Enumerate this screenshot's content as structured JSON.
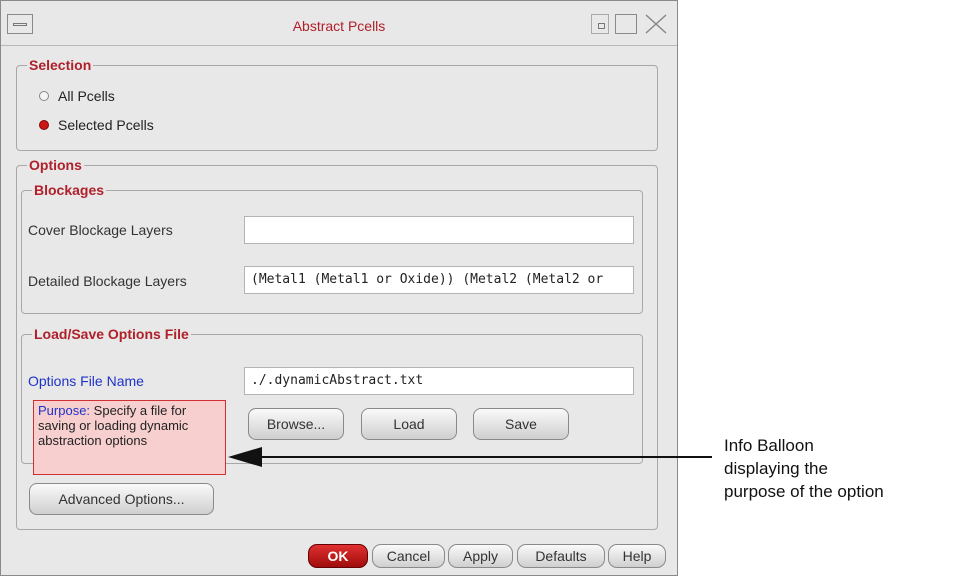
{
  "window": {
    "title": "Abstract Pcells"
  },
  "selection": {
    "legend": "Selection",
    "options": [
      {
        "label": "All Pcells",
        "selected": false
      },
      {
        "label": "Selected Pcells",
        "selected": true
      }
    ]
  },
  "options": {
    "legend": "Options",
    "blockages": {
      "legend": "Blockages",
      "cover_label": "Cover Blockage Layers",
      "cover_value": "",
      "detailed_label": "Detailed Blockage Layers",
      "detailed_value": "(Metal1 (Metal1 or Oxide)) (Metal2 (Metal2 or"
    },
    "load_save": {
      "legend": "Load/Save Options File",
      "file_label": "Options File Name",
      "file_value": "./.dynamicAbstract.txt",
      "browse_label": "Browse...",
      "load_label": "Load",
      "save_label": "Save"
    },
    "advanced_label": "Advanced Options..."
  },
  "balloon": {
    "key": "Purpose:",
    "text": "Specify a file for saving or loading dynamic abstraction options"
  },
  "footer": {
    "ok_label": "OK",
    "cancel_label": "Cancel",
    "apply_label": "Apply",
    "defaults_label": "Defaults",
    "help_label": "Help"
  },
  "callout": {
    "text": "Info Balloon displaying the purpose of the option"
  },
  "colors": {
    "legend_red": "#b0202a",
    "label_blue": "#1e33c8",
    "ok_red": "#c41818",
    "balloon_fill": "#f7cfcf"
  }
}
